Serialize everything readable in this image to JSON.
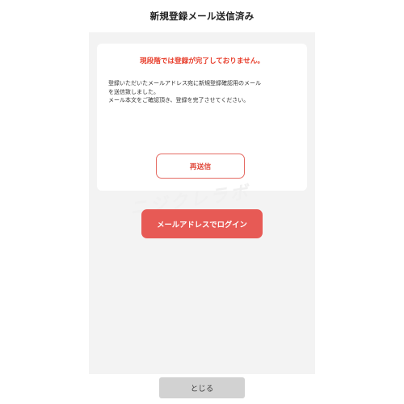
{
  "header": {
    "title": "新規登録メール送信済み"
  },
  "card": {
    "warning": "現段階では登録が完了しておりません。",
    "message": "登録いただいたメールアドレス宛に新規登録確認用のメール\nを送信致しました。\nメール本文をご確認頂き、登録を完了させてください。",
    "resend_label": "再送信"
  },
  "main": {
    "login_label": "メールアドレスでログイン",
    "watermark": "ニジクレラボ"
  },
  "footer": {
    "close_label": "とじる"
  },
  "colors": {
    "accent": "#e75a55",
    "warning_text": "#e8402e",
    "background": "#f3f3f3"
  }
}
